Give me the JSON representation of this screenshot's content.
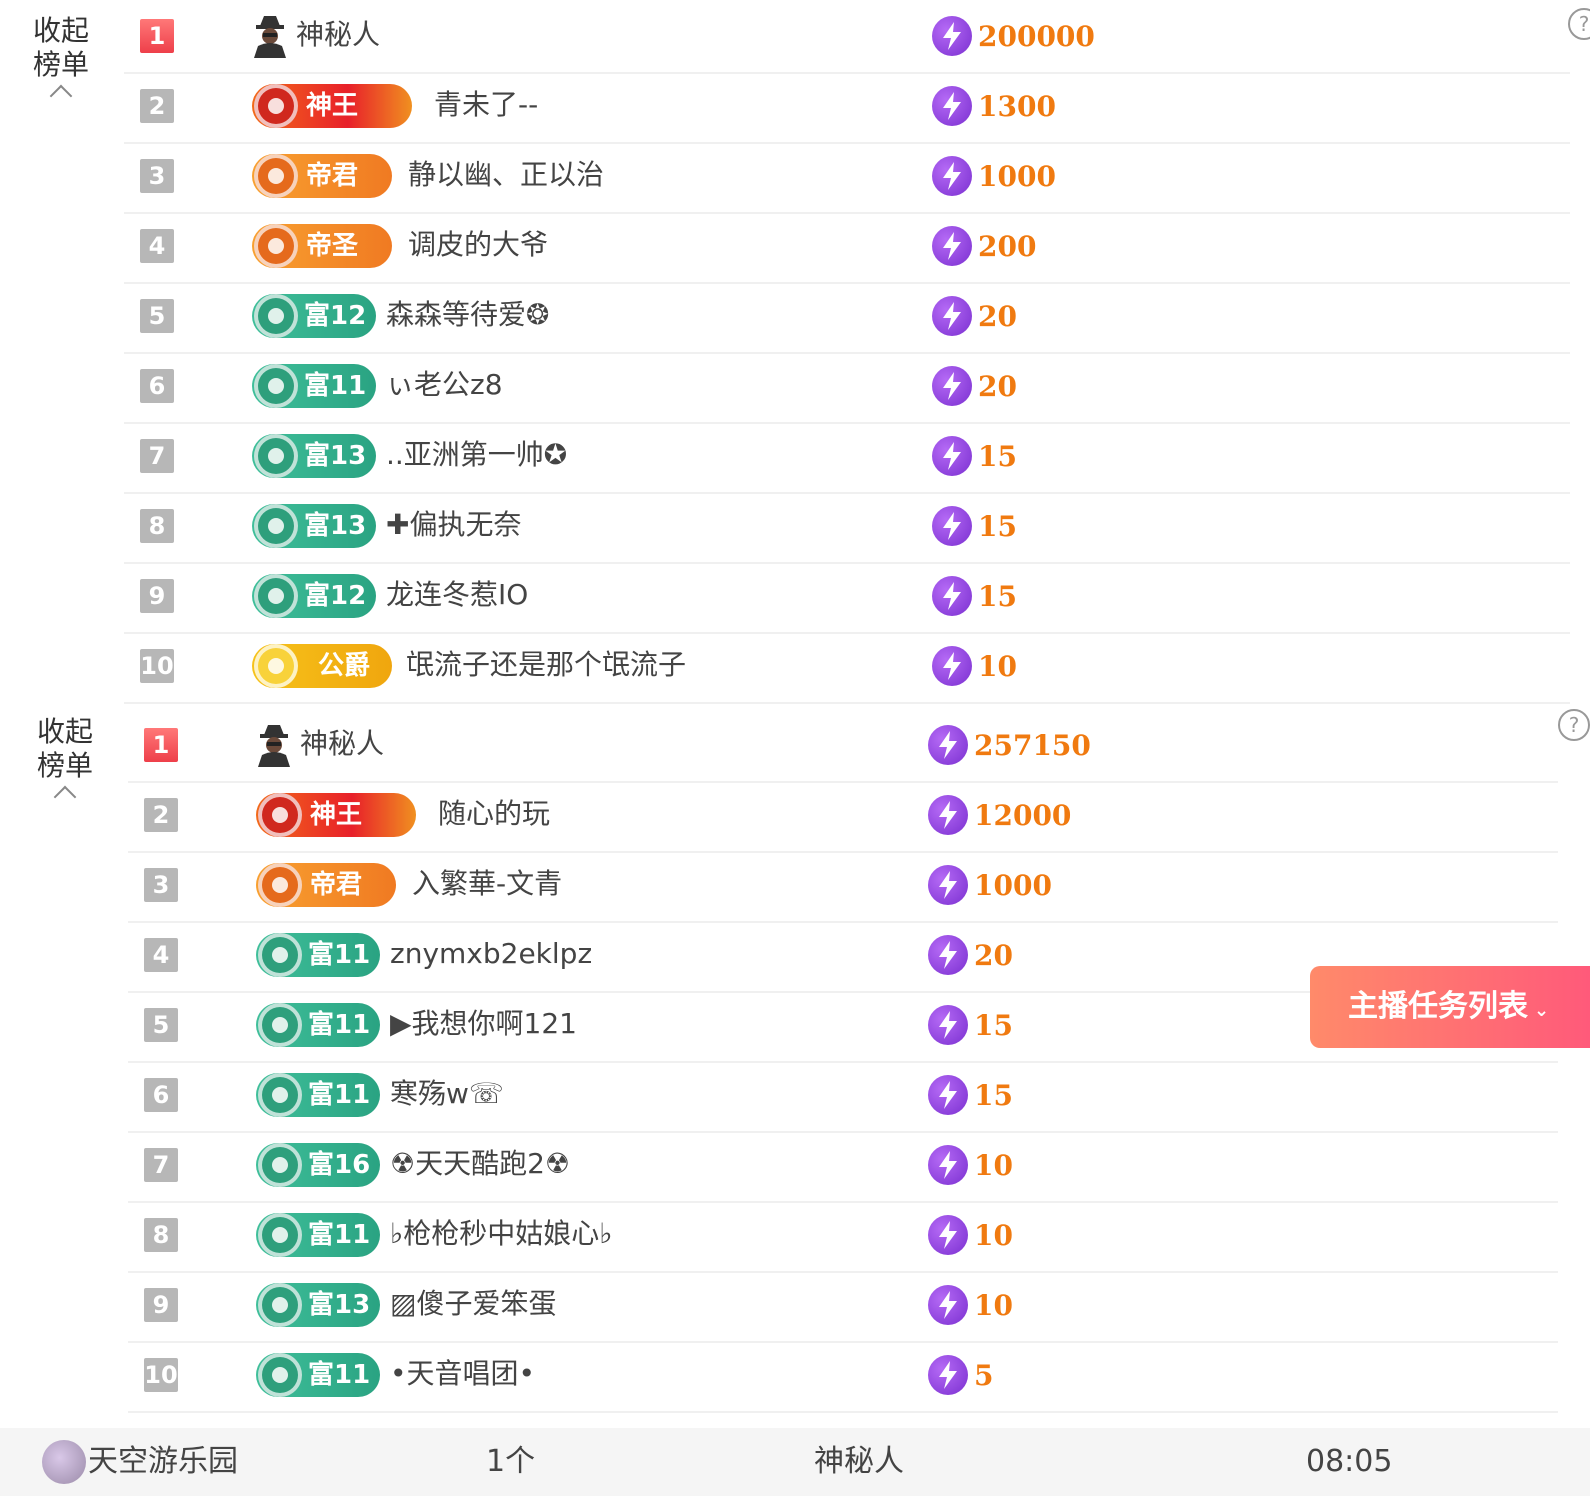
{
  "boards": [
    {
      "collapse_label": "收起榜单",
      "rows": [
        {
          "rank": "1",
          "badge": null,
          "name": "神秘人",
          "score": "200000"
        },
        {
          "rank": "2",
          "badge": {
            "type": "red",
            "label": "神王"
          },
          "name": "青未了--",
          "score": "1300"
        },
        {
          "rank": "3",
          "badge": {
            "type": "orange",
            "label": "帝君"
          },
          "name": "静以幽、正以治",
          "score": "1000"
        },
        {
          "rank": "4",
          "badge": {
            "type": "orange",
            "label": "帝圣"
          },
          "name": "调皮的大爷",
          "score": "200"
        },
        {
          "rank": "5",
          "badge": {
            "type": "green",
            "label": "富12"
          },
          "name": "森森等待爱❂",
          "score": "20"
        },
        {
          "rank": "6",
          "badge": {
            "type": "green",
            "label": "富11"
          },
          "name": "ぃ老公z8",
          "score": "20"
        },
        {
          "rank": "7",
          "badge": {
            "type": "green",
            "label": "富13"
          },
          "name": "..亚洲第一帅✪",
          "score": "15"
        },
        {
          "rank": "8",
          "badge": {
            "type": "green",
            "label": "富13"
          },
          "name": "✚偏执无奈",
          "score": "15"
        },
        {
          "rank": "9",
          "badge": {
            "type": "green",
            "label": "富12"
          },
          "name": "龙连冬惹IO",
          "score": "15"
        },
        {
          "rank": "10",
          "badge": {
            "type": "gold",
            "label": "公爵"
          },
          "name": "氓流子还是那个氓流子",
          "score": "10"
        }
      ]
    },
    {
      "collapse_label": "收起榜单",
      "rows": [
        {
          "rank": "1",
          "badge": null,
          "name": "神秘人",
          "score": "257150"
        },
        {
          "rank": "2",
          "badge": {
            "type": "red",
            "label": "神王"
          },
          "name": "随心的玩",
          "score": "12000"
        },
        {
          "rank": "3",
          "badge": {
            "type": "orange",
            "label": "帝君"
          },
          "name": "入繁華-文青",
          "score": "1000"
        },
        {
          "rank": "4",
          "badge": {
            "type": "green",
            "label": "富11"
          },
          "name": "znymxb2eklpz",
          "score": "20"
        },
        {
          "rank": "5",
          "badge": {
            "type": "green",
            "label": "富11"
          },
          "name": "▶我想你啊121",
          "score": "15"
        },
        {
          "rank": "6",
          "badge": {
            "type": "green",
            "label": "富11"
          },
          "name": "寒殇w☏",
          "score": "15"
        },
        {
          "rank": "7",
          "badge": {
            "type": "green",
            "label": "富16"
          },
          "name": "☢天天酷跑2☢",
          "score": "10"
        },
        {
          "rank": "8",
          "badge": {
            "type": "green",
            "label": "富11"
          },
          "name": "♭枪枪秒中姑娘心♭",
          "score": "10"
        },
        {
          "rank": "9",
          "badge": {
            "type": "green",
            "label": "富13"
          },
          "name": "▨傻子爱笨蛋",
          "score": "10"
        },
        {
          "rank": "10",
          "badge": {
            "type": "green",
            "label": "富11"
          },
          "name": "•天音唱团•",
          "score": "5"
        }
      ]
    }
  ],
  "task_button": {
    "label": "主播任务列表",
    "caret": "⌄"
  },
  "footer": {
    "room_name": "天空游乐园",
    "count": "1个",
    "user": "神秘人",
    "time": "08:05"
  },
  "icons": {
    "help": "question-circle-icon",
    "bolt": "lightning-icon",
    "mystery": "mystery-user-icon"
  },
  "colors": {
    "score": "#f07a10",
    "rank_first": "#f25a5a",
    "rank_other": "#b7b7b7",
    "task_button": "#ff6a78"
  }
}
